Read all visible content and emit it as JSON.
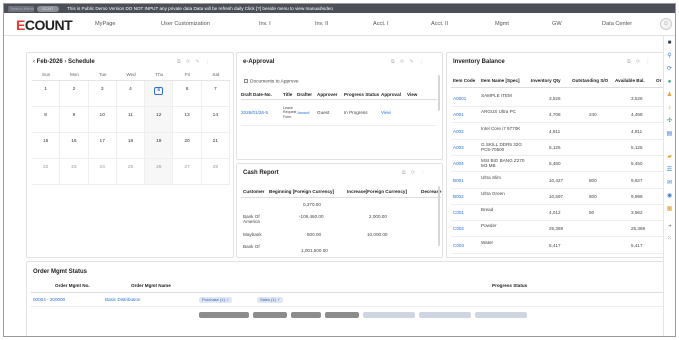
{
  "topbar": {
    "search_placeholder": "Search Menu",
    "pill_label": "ECNT",
    "notice": "This is Public Demo Version    DO NOT INPUT any private data    Data will be refresh daily    Click [?] beside menu to view manual/video"
  },
  "nav": {
    "logo_e": "E",
    "logo_rest": "COUNT",
    "items": [
      "MyPage",
      "User Customization",
      "Inv. I",
      "Inv. II",
      "Acct. I",
      "Acct. II",
      "Mgmt",
      "GW",
      "Data Center"
    ]
  },
  "schedule": {
    "month": "Feb-2026",
    "title": "Schedule",
    "tools": "⧉ ⟳ ✎ ⋮",
    "days_of_week": [
      "Sun",
      "Mon",
      "Tue",
      "Wed",
      "Thu",
      "Fri",
      "Sat"
    ],
    "weeks": [
      [
        "1",
        "2",
        "3",
        "4",
        "5",
        "6",
        "7"
      ],
      [
        "8",
        "9",
        "10",
        "11",
        "12",
        "13",
        "14"
      ],
      [
        "15",
        "16",
        "17",
        "18",
        "19",
        "20",
        "21"
      ],
      [
        "22",
        "23",
        "24",
        "25",
        "26",
        "27",
        "28"
      ]
    ],
    "today": "5"
  },
  "approval": {
    "title": "e-Approval",
    "tools": "⧉ ⟳ ✎ ⋮",
    "filter_label": "Documents to Approve",
    "headers": [
      "Draft Date-No.",
      "Title",
      "Drafter",
      "Approver",
      "Progress Status",
      "Approval",
      "View"
    ],
    "rows": [
      {
        "draft": "2026/01/26-5",
        "title": "Leave Request Form",
        "drafter": "Jamanli",
        "approver": "Guest",
        "status": "In Progress",
        "view": "View"
      }
    ]
  },
  "cash": {
    "title": "Cash Report",
    "tools": "⧉ ⟳ ⋮",
    "headers": [
      "Customer",
      "Beginning [Foreign Currency]",
      "Increase[Foreign Currency]",
      "Decrease"
    ],
    "rows": [
      {
        "customer": "",
        "beginning": "0,370.00",
        "increase": ""
      },
      {
        "customer": "Bank Of America",
        "beginning": "-109,460.00",
        "increase": "2,000.00"
      },
      {
        "customer": "Maybank",
        "beginning": "500.00",
        "increase": "10,000.00"
      },
      {
        "customer": "Bank Of",
        "beginning": "1,001,500.00",
        "increase": ""
      }
    ]
  },
  "inventory": {
    "title": "Inventory Balance",
    "tools": "⧉ ⟳ ⋮",
    "headers": [
      "Item Code",
      "Item Name [Spec]",
      "Inventory Qty",
      "Outstanding S/O",
      "Available Bal.",
      "Or"
    ],
    "rows": [
      {
        "code": "A0001",
        "name": "SAMPLE ITEM",
        "qty": "3,526",
        "so": "",
        "bal": "3,526"
      },
      {
        "code": "A001",
        "name": "ARGUS Ultra PC",
        "qty": "4,708",
        "so": "240",
        "bal": "4,468"
      },
      {
        "code": "A002",
        "name": "Intel Core i7 9770K",
        "qty": "4,811",
        "so": "",
        "bal": "4,811"
      },
      {
        "code": "A003",
        "name": "G.SKILL DDR5 32G PC5-70500",
        "qty": "5,125",
        "so": "",
        "bal": "5,125"
      },
      {
        "code": "A004",
        "name": "MSI BIG BANG Z270 M3 MB",
        "qty": "5,450",
        "so": "",
        "bal": "5,450"
      },
      {
        "code": "B001",
        "name": "Ultra Slim",
        "qty": "10,427",
        "so": "800",
        "bal": "9,627"
      },
      {
        "code": "B002",
        "name": "Ultra Green",
        "qty": "10,597",
        "so": "600",
        "bal": "9,998"
      },
      {
        "code": "C001",
        "name": "Bread",
        "qty": "4,012",
        "so": "50",
        "bal": "3,962"
      },
      {
        "code": "C002",
        "name": "Powder",
        "qty": "25,369",
        "so": "",
        "bal": "25,369"
      },
      {
        "code": "C003",
        "name": "Water",
        "qty": "5,417",
        "so": "",
        "bal": "5,417"
      }
    ]
  },
  "orders": {
    "title": "Order Mgmt Status",
    "headers": [
      "Order Mgmt No.",
      "Order Mgmt Name",
      "Progress Status"
    ],
    "rows": [
      {
        "no": "00004 - 200000",
        "name": "Basic Distribution",
        "tags": [
          "Purchase (1) ✓",
          "Sales (1) ✓"
        ]
      }
    ]
  },
  "sidebar_icons": [
    "grid-icon",
    "search-icon",
    "refresh-icon",
    "message-icon",
    "person-icon",
    "bell-icon",
    "settings-icon",
    "chart-icon",
    "folder-icon",
    "list-icon",
    "mail-icon",
    "help-icon",
    "calendar-icon"
  ]
}
